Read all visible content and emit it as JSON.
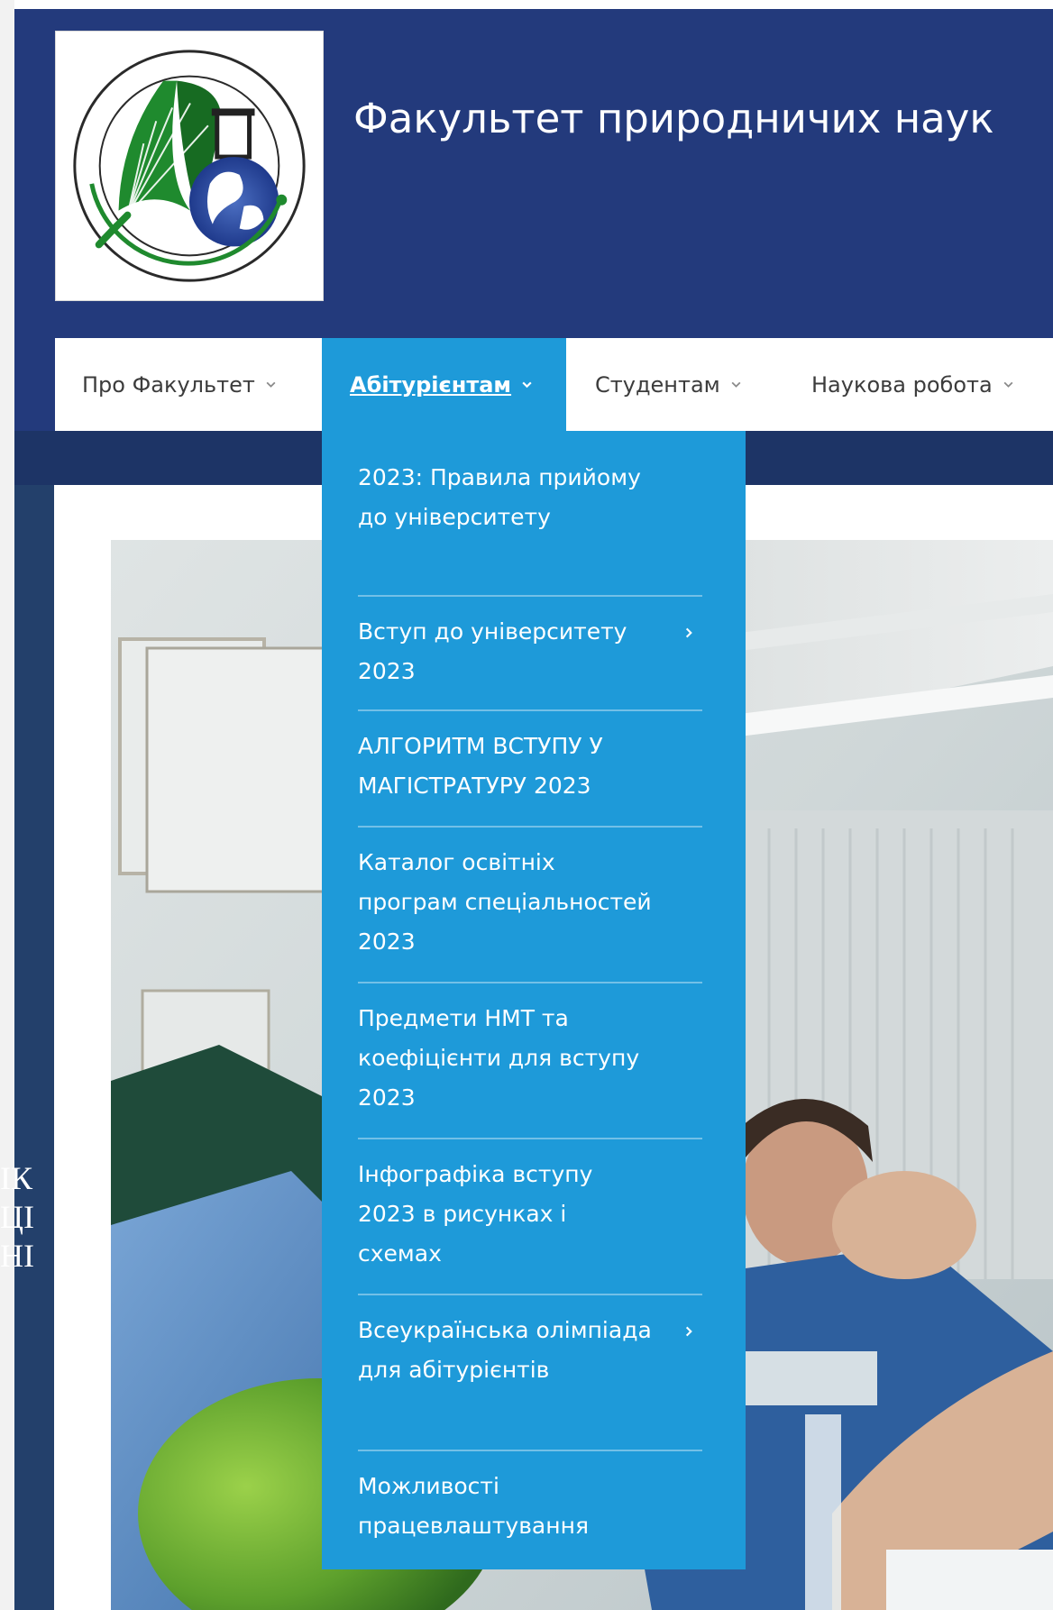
{
  "site": {
    "title": "Факультет природничих наук"
  },
  "nav": {
    "items": [
      {
        "label": "Про Факультет",
        "active": false
      },
      {
        "label": "Абітурієнтам",
        "active": true
      },
      {
        "label": "Студентам",
        "active": false
      },
      {
        "label": "Наукова робота",
        "active": false
      }
    ]
  },
  "dropdown": {
    "items": [
      {
        "label": "2023: Правила прийому до університету",
        "has_submenu": false
      },
      {
        "label": "Вступ до університету 2023",
        "has_submenu": true
      },
      {
        "label": "АЛГОРИТМ ВСТУПУ У МАГІСТРАТУРУ 2023",
        "has_submenu": false
      },
      {
        "label": "Каталог освітніх програм спеціальностей 2023",
        "has_submenu": false
      },
      {
        "label": "Предмети НМТ та коефіцієнти для вступу 2023",
        "has_submenu": false
      },
      {
        "label": "Інфографіка вступу 2023 в рисунках і схемах",
        "has_submenu": false
      },
      {
        "label": "Всеукраїнська олімпіада для абітурієнтів",
        "has_submenu": true
      },
      {
        "label": "Можливості працевлаштування",
        "has_submenu": false
      }
    ]
  },
  "hero": {
    "partial_text": [
      "ІК",
      "ЦІ",
      "НІ"
    ]
  },
  "colors": {
    "header_bg": "#233a7c",
    "nav_bg": "#ffffff",
    "active_bg": "#1e9ad9",
    "dropdown_bg": "#1e9ad9",
    "text_white": "#ffffff",
    "nav_text": "#3c3c3c"
  },
  "icons": {
    "nav_chevron": "chevron-down-icon",
    "submenu_arrow": "chevron-right-icon",
    "logo": "faculty-logo-icon"
  }
}
